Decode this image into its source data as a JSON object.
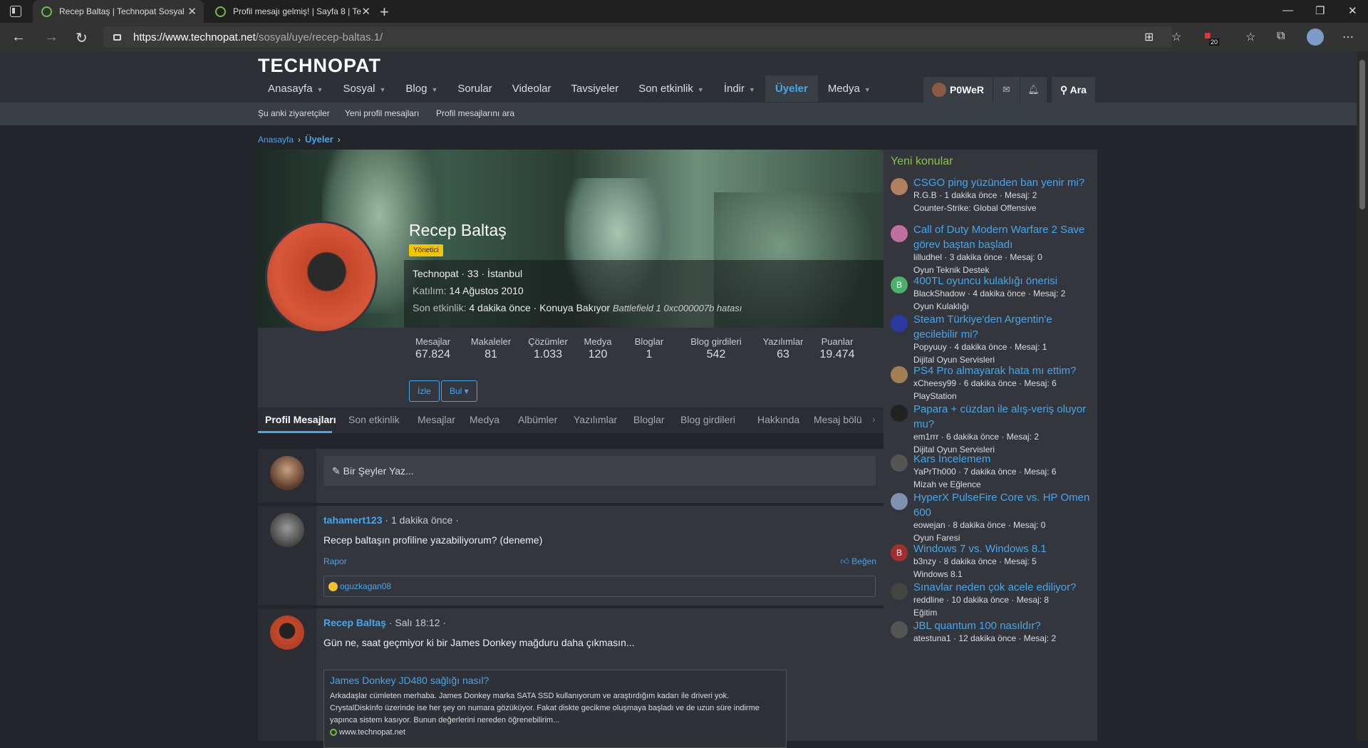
{
  "browser": {
    "tabs": [
      {
        "title": "Recep Baltaş | Technopat Sosyal"
      },
      {
        "title": "Profil mesajı gelmiş! | Sayfa 8 | Te"
      }
    ],
    "url_host": "https://www.technopat.net",
    "url_path": "/sosyal/uye/recep-baltas.1/",
    "badge_count": "20"
  },
  "site": {
    "logo": "TECHNOPAT",
    "nav": [
      {
        "label": "Anasayfa",
        "caret": true
      },
      {
        "label": "Sosyal",
        "caret": true
      },
      {
        "label": "Blog",
        "caret": true
      },
      {
        "label": "Sorular",
        "caret": false
      },
      {
        "label": "Videolar",
        "caret": false
      },
      {
        "label": "Tavsiyeler",
        "caret": false
      },
      {
        "label": "Son etkinlik",
        "caret": true
      },
      {
        "label": "İndir",
        "caret": true
      },
      {
        "label": "Üyeler",
        "caret": false
      },
      {
        "label": "Medya",
        "caret": true
      }
    ],
    "user": "P0WeR",
    "search": "Ara",
    "subnav": [
      "Şu anki ziyaretçiler",
      "Yeni profil mesajları",
      "Profil mesajlarını ara"
    ],
    "breadcrumb": [
      "Anasayfa",
      "Üyeler"
    ]
  },
  "profile": {
    "name": "Recep Baltaş",
    "role": "Yönetici",
    "line1": "Technopat · 33 · İstanbul",
    "joined_label": "Katılım:",
    "joined": "14 Ağustos 2010",
    "activity_label": "Son etkinlik:",
    "activity": "4 dakika önce · Konuya Bakıyor",
    "activity_topic": "Battlefield 1 0xc000007b hatası",
    "stats": [
      {
        "label": "Mesajlar",
        "value": "67.824"
      },
      {
        "label": "Makaleler",
        "value": "81"
      },
      {
        "label": "Çözümler",
        "value": "1.033"
      },
      {
        "label": "Medya",
        "value": "120"
      },
      {
        "label": "Bloglar",
        "value": "1"
      },
      {
        "label": "Blog girdileri",
        "value": "542"
      },
      {
        "label": "Yazılımlar",
        "value": "63"
      },
      {
        "label": "Puanlar",
        "value": "19.474"
      }
    ],
    "btn_watch": "İzle",
    "btn_find": "Bul ▾",
    "tabs": [
      "Profil Mesajları",
      "Son etkinlik",
      "Mesajlar",
      "Medya",
      "Albümler",
      "Yazılımlar",
      "Bloglar",
      "Blog girdileri",
      "Hakkında",
      "Mesaj bölü"
    ]
  },
  "composer": {
    "placeholder": "Bir Şeyler Yaz..."
  },
  "posts": [
    {
      "author": "tahamert123",
      "time": "· 1 dakika önce ·",
      "text": "Recep baltaşın profiline yazabiliyorum? (deneme)",
      "report": "Rapor",
      "like": "Beğen",
      "liked_by": "oguzkagan08"
    },
    {
      "author": "Recep Baltaş",
      "time": "· Salı 18:12 ·",
      "text": "Gün ne, saat geçmiyor ki bir James Donkey mağduru daha çıkmasın...",
      "embed_title": "James Donkey JD480 sağlığı nasıl?",
      "embed_desc": "Arkadaşlar cümleten merhaba. James Donkey marka SATA SSD kullanıyorum ve araştırdığım kadarı ile driveri yok. CrystalDiskInfo üzerinde ise her şey on numara gözüküyor. Fakat diskte gecikme oluşmaya başladı ve de uzun süre indirme yapınca sistem kasıyor. Bunun değerlerini nereden öğrenebilirim...",
      "embed_site": "www.technopat.net"
    }
  ],
  "sidebar": {
    "heading": "Yeni konular",
    "items": [
      {
        "title": "CSGO ping yüzünden ban yenir mi?",
        "meta": "R.G.B · 1 dakika önce · Mesaj: 2",
        "forum": "Counter-Strike: Global Offensive",
        "av_color": "#b08060",
        "letter": ""
      },
      {
        "title": "Call of Duty Modern Warfare 2 Save görev baştan başladı",
        "meta": "lilludhel · 3 dakika önce · Mesaj: 0",
        "forum": "Oyun Teknik Destek",
        "av_color": "#c070a0",
        "letter": ""
      },
      {
        "title": "400TL oyuncu kulaklığı önerisi",
        "meta": "BlackShadow · 4 dakika önce · Mesaj: 2",
        "forum": "Oyun Kulaklığı",
        "av_color": "#4caf6a",
        "letter": "B"
      },
      {
        "title": "Steam Türkiye'den Argentin'e gecilebilir mi?",
        "meta": "Popyuuy · 4 dakika önce · Mesaj: 1",
        "forum": "Dijital Oyun Servisleri",
        "av_color": "#2a3aa0",
        "letter": ""
      },
      {
        "title": "PS4 Pro almayarak hata mı ettim?",
        "meta": "xCheesy99 · 6 dakika önce · Mesaj: 6",
        "forum": "PlayStation",
        "av_color": "#a08050",
        "letter": ""
      },
      {
        "title": "Papara + cüzdan ile alış-veriş oluyor mu?",
        "meta": "em1rrr · 6 dakika önce · Mesaj: 2",
        "forum": "Dijital Oyun Servisleri",
        "av_color": "#222222",
        "letter": ""
      },
      {
        "title": "Kars İncelemem",
        "meta": "YaPrTh000 · 7 dakika önce · Mesaj: 6",
        "forum": "Mizah ve Eğlence",
        "av_color": "#555555",
        "letter": ""
      },
      {
        "title": "HyperX PulseFire Core vs. HP Omen 600",
        "meta": "eowejan · 8 dakika önce · Mesaj: 0",
        "forum": "Oyun Faresi",
        "av_color": "#8090b0",
        "letter": ""
      },
      {
        "title": "Windows 7 vs. Windows 8.1",
        "meta": "b3nzy · 8 dakika önce · Mesaj: 5",
        "forum": "Windows 8.1",
        "av_color": "#a03030",
        "letter": "B"
      },
      {
        "title": "Sınavlar neden çok acele ediliyor?",
        "meta": "reddline · 10 dakika önce · Mesaj: 8",
        "forum": "Eğitim",
        "av_color": "#444444",
        "letter": ""
      },
      {
        "title": "JBL quantum 100 nasıldır?",
        "meta": "atestuna1 · 12 dakika önce · Mesaj: 2",
        "forum": "",
        "av_color": "#555555",
        "letter": ""
      }
    ]
  }
}
